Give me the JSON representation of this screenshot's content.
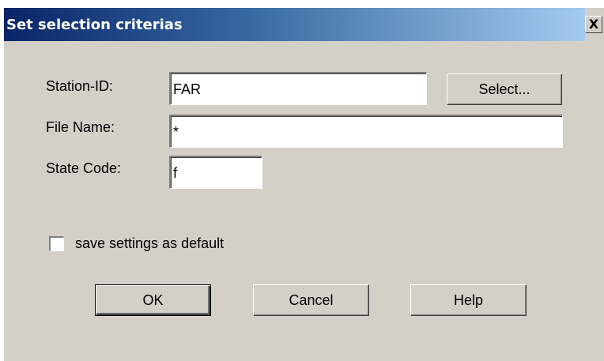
{
  "dialog": {
    "title": "Set selection criterias",
    "close_label": "X"
  },
  "form": {
    "station_id_label": "Station-ID:",
    "station_id_value": "FAR",
    "select_button_label": "Select...",
    "file_name_label": "File Name:",
    "file_name_value": "*",
    "state_code_label": "State Code:",
    "state_code_value": "f",
    "save_default_label": "save settings as default",
    "save_default_checked": false
  },
  "buttons": {
    "ok_label": "OK",
    "cancel_label": "Cancel",
    "help_label": "Help"
  }
}
